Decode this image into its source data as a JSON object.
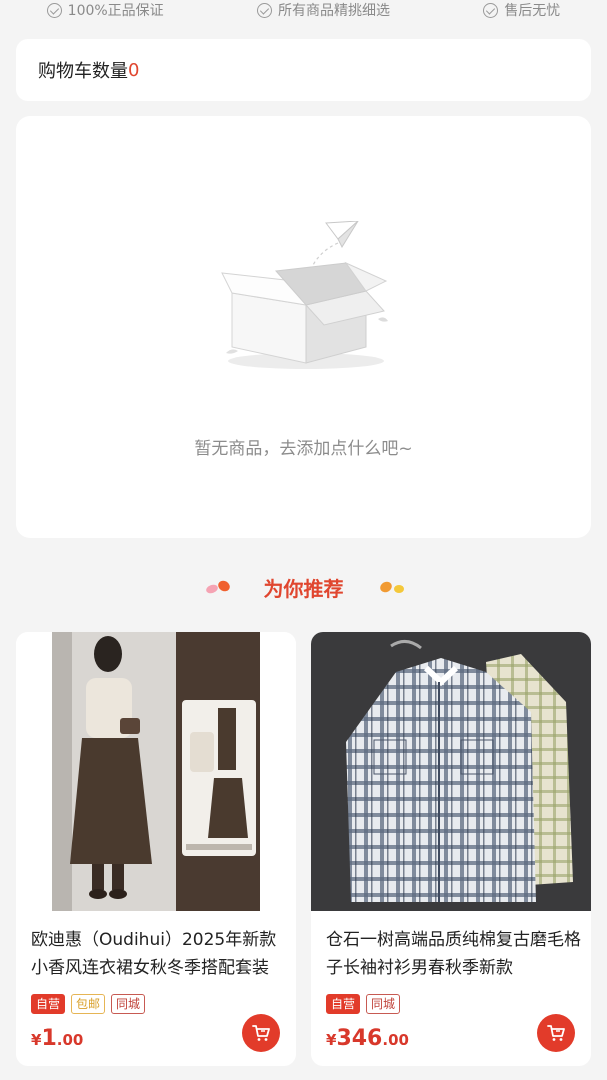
{
  "guarantees": [
    {
      "label": "100%正品保证",
      "icon": "check-circle-icon"
    },
    {
      "label": "所有商品精挑细选",
      "icon": "check-circle-icon"
    },
    {
      "label": "售后无忧",
      "icon": "check-circle-icon"
    }
  ],
  "cart": {
    "count_label": "购物车数量",
    "count": "0"
  },
  "empty_state": {
    "message": "暂无商品，去添加点什么吧~",
    "icon": "empty-box-icon"
  },
  "recommend": {
    "title": "为你推荐"
  },
  "products": [
    {
      "title": "欧迪惠（Oudihui）2025年新款小香风连衣裙女秋冬季搭配套装",
      "tags": [
        "自营",
        "包邮",
        "同城"
      ],
      "currency": "¥",
      "price_int": "1",
      "price_dec": ".00"
    },
    {
      "title": "仓石一树高端品质纯棉复古磨毛格子长袖衬衫男春秋季新款",
      "tags": [
        "自营",
        "同城"
      ],
      "currency": "¥",
      "price_int": "346",
      "price_dec": ".00"
    }
  ],
  "colors": {
    "accent": "#e0462f",
    "page_bg": "#f4f4f4"
  }
}
